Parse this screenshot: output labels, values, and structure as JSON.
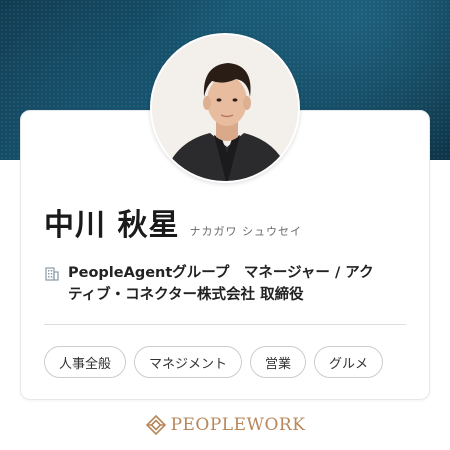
{
  "profile": {
    "name": "中川 秋星",
    "kana": "ナカガワ シュウセイ",
    "title_line1": "PeopleAgentグループ　マネージャー / アク",
    "title_line2": "ティブ・コネクター株式会社 取締役"
  },
  "tags": [
    "人事全般",
    "マネジメント",
    "営業",
    "グルメ"
  ],
  "footer": {
    "logo_text": "PEOPLEWORK"
  },
  "colors": {
    "hero": "#14506a",
    "accent_gold": "#b8875a",
    "tag_border": "#c9cdd1"
  },
  "icons": {
    "company": "building-icon",
    "brand": "peoplework-logo-icon"
  }
}
